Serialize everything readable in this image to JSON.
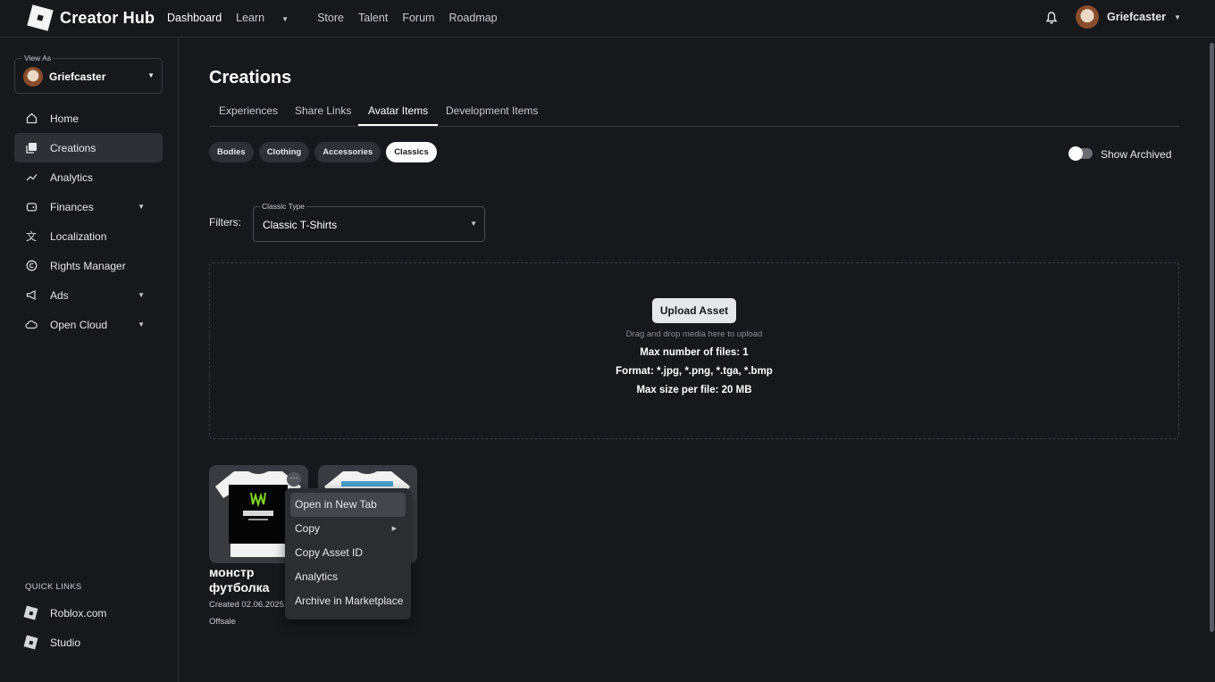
{
  "app": {
    "title": "Creator Hub"
  },
  "topnav": [
    {
      "label": "Dashboard",
      "active": true
    },
    {
      "label": "Learn",
      "dropdown": true
    },
    {
      "label": "Store"
    },
    {
      "label": "Talent"
    },
    {
      "label": "Forum"
    },
    {
      "label": "Roadmap"
    }
  ],
  "user": {
    "name": "Griefcaster"
  },
  "sidebar": {
    "view_as_label": "View As",
    "view_as_name": "Griefcaster",
    "items": [
      {
        "label": "Home",
        "icon": "home-icon"
      },
      {
        "label": "Creations",
        "icon": "creations-icon",
        "active": true
      },
      {
        "label": "Analytics",
        "icon": "analytics-icon"
      },
      {
        "label": "Finances",
        "icon": "finances-icon",
        "dropdown": true
      },
      {
        "label": "Localization",
        "icon": "localization-icon"
      },
      {
        "label": "Rights Manager",
        "icon": "copyright-icon"
      },
      {
        "label": "Ads",
        "icon": "megaphone-icon",
        "dropdown": true
      },
      {
        "label": "Open Cloud",
        "icon": "cloud-icon",
        "dropdown": true
      }
    ],
    "quick_links_title": "QUICK LINKS",
    "quick_links": [
      "Roblox.com",
      "Studio"
    ]
  },
  "page": {
    "title": "Creations",
    "tabs": [
      "Experiences",
      "Share Links",
      "Avatar Items",
      "Development Items"
    ],
    "active_tab": "Avatar Items",
    "chips": [
      "Bodies",
      "Clothing",
      "Accessories",
      "Classics"
    ],
    "active_chip": "Classics",
    "show_archived_label": "Show Archived",
    "show_archived": false,
    "filters_label": "Filters:",
    "classic_type_label": "Classic Type",
    "classic_type_value": "Classic T-Shirts"
  },
  "upload": {
    "button": "Upload Asset",
    "hint": "Drag and drop media here to upload",
    "max_files": "Max number of files: 1",
    "format": "Format: *.jpg, *.png, *.tga, *.bmp",
    "max_size": "Max size per file: 20 MB"
  },
  "items": [
    {
      "title": "монстр футболка",
      "created": "Created 02.06.2025",
      "status": "Offsale"
    }
  ],
  "context_menu": {
    "items": [
      "Open in New Tab",
      "Copy",
      "Copy Asset ID",
      "Analytics",
      "Archive in Marketplace"
    ]
  },
  "colors": {
    "background": "#17181c",
    "active_nav": "#2e3035",
    "menu": "#2b2d31",
    "accent_white": "#ffffff"
  }
}
